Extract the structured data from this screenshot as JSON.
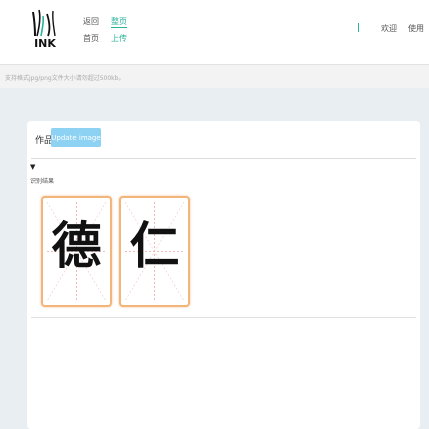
{
  "header": {
    "logo_text": "INK",
    "nav": {
      "back": "返回",
      "home": "首页",
      "gallery": "整页",
      "upload": "上传",
      "welcome": "欢迎",
      "use": "使用"
    }
  },
  "notice": {
    "text": "支持格式jpg/png文件大小请勿超过500kb。"
  },
  "card": {
    "title": "作品",
    "upload_button": "Update image",
    "toggle_icon": "▼",
    "section_label": "识别结果",
    "characters": [
      "德",
      "仁"
    ]
  },
  "colors": {
    "accent": "#2bb39a",
    "button": "#8dd2f3",
    "tile_border": "#f2b57a",
    "page_bg": "#e9eef3"
  }
}
